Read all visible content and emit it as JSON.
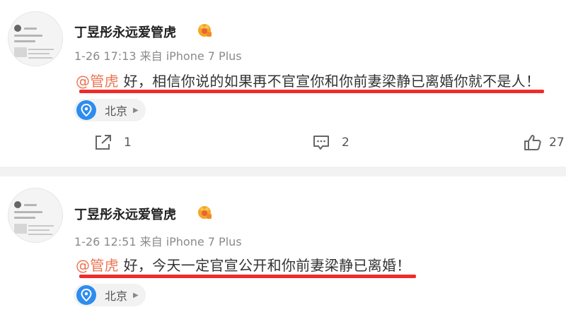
{
  "posts": [
    {
      "username": "丁昱彤永远爱管虎",
      "badge_icon": "vip-crown-badge",
      "timestamp": "1-26 17:13",
      "source": "来自 iPhone 7 Plus",
      "mention": "@管虎",
      "text": " 好，相信你说的如果再不官宣你和你前妻梁静已离婚你就不是人！",
      "location": "北京",
      "repost_count": "1",
      "comment_count": "2",
      "like_count": "27"
    },
    {
      "username": "丁昱彤永远爱管虎",
      "badge_icon": "vip-crown-badge",
      "timestamp": "1-26 12:51",
      "source": "来自 iPhone 7 Plus",
      "mention": "@管虎",
      "text": " 好，今天一定官宣公开和你前妻梁静已离婚！",
      "location": "北京"
    }
  ],
  "colors": {
    "mention": "#eb7350",
    "underline": "#f02b2b",
    "location_pin": "#2d8cf0",
    "separator": "#f2f2f2"
  }
}
